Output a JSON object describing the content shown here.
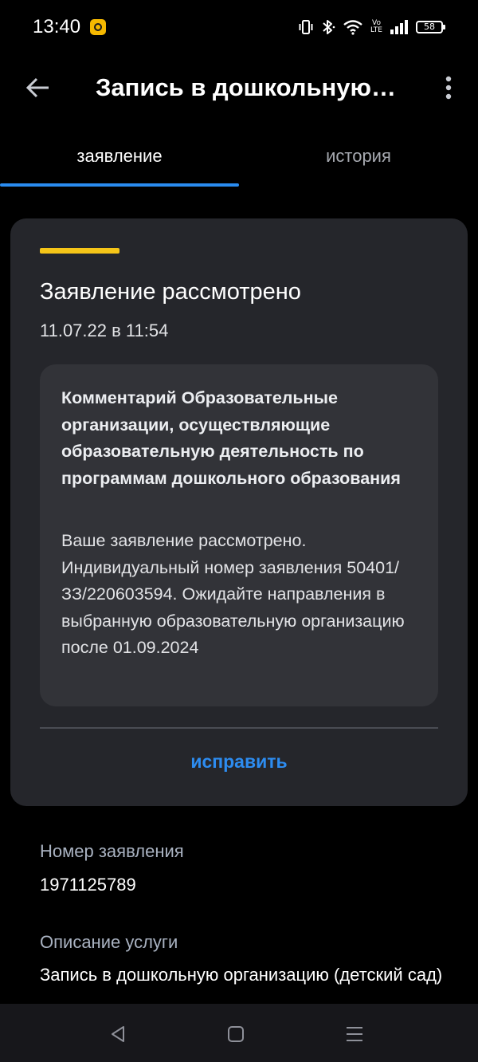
{
  "status_bar": {
    "time": "13:40",
    "battery": "58",
    "network_label": "Vo\nLTE"
  },
  "app_bar": {
    "title": "Запись в дошкольную организацию (детский сад)"
  },
  "tabs": [
    {
      "label": "заявление",
      "active": true
    },
    {
      "label": "история",
      "active": false
    }
  ],
  "status_card": {
    "title": "Заявление рассмотрено",
    "date": "11.07.22 в 11:54",
    "comment_title": "Комментарий Образовательные организации, осуществляющие образовательную деятельность по программам дошкольного образования",
    "comment_text": "Ваше заявление рассмотрено. Индивидуальный номер заявления 50401/ЗЗ/220603594. Ожидайте направления в выбранную образовательную организацию после 01.09.2024",
    "action_label": "исправить",
    "accent_color": "#f5c518"
  },
  "details": [
    {
      "label": "Номер заявления",
      "value": "1971125789"
    },
    {
      "label": "Описание услуги",
      "value": "Запись в дошкольную организацию (детский сад)"
    }
  ],
  "colors": {
    "background": "#000000",
    "card": "#25262b",
    "comment_box": "#323338",
    "accent_blue": "#2a8cf0"
  }
}
